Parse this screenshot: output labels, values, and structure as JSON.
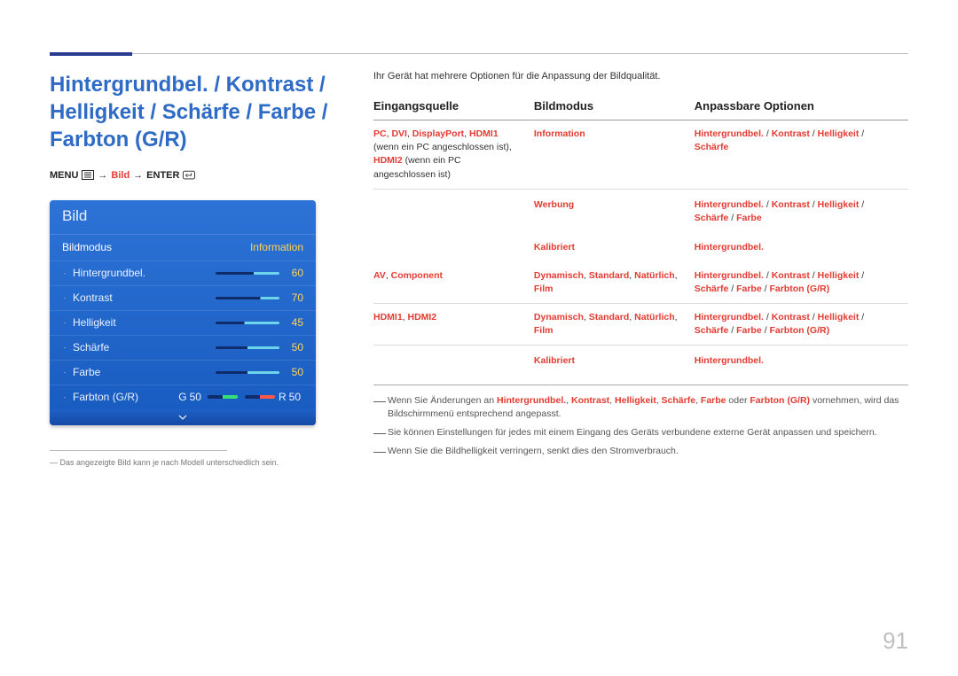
{
  "title": "Hintergrundbel. / Kontrast / Helligkeit / Schärfe / Farbe / Farbton (G/R)",
  "breadcrumb": {
    "menu": "MENU",
    "arrow": "→",
    "item": "Bild",
    "enter": "ENTER"
  },
  "menu": {
    "header": "Bild",
    "top_row": {
      "label": "Bildmodus",
      "value": "Information"
    },
    "rows": [
      {
        "label": "Hintergrundbel.",
        "value": "60",
        "pct": 60
      },
      {
        "label": "Kontrast",
        "value": "70",
        "pct": 70
      },
      {
        "label": "Helligkeit",
        "value": "45",
        "pct": 45
      },
      {
        "label": "Schärfe",
        "value": "50",
        "pct": 50
      },
      {
        "label": "Farbe",
        "value": "50",
        "pct": 50
      }
    ],
    "gr": {
      "label": "Farbton (G/R)",
      "g_lbl": "G",
      "g_val": "50",
      "r_lbl": "R",
      "r_val": "50"
    }
  },
  "footnote": "Das angezeigte Bild kann je nach Modell unterschiedlich sein.",
  "intro": "Ihr Gerät hat mehrere Optionen für die Anpassung der Bildqualität.",
  "table": {
    "headers": [
      "Eingangsquelle",
      "Bildmodus",
      "Anpassbare Optionen"
    ],
    "rows": [
      {
        "src_html": "<span class='red'>PC</span><span class='blk'>, </span><span class='red'>DVI</span><span class='blk'>, </span><span class='red'>DisplayPort</span><span class='blk'>, </span><span class='red'>HDMI1</span><span class='blk'> (wenn ein PC angeschlossen ist), </span><span class='red'>HDMI2</span><span class='blk'> (wenn ein PC angeschlossen ist)</span>",
        "mode_html": "<span class='red'>Information</span>",
        "opt_html": "<span class='red'>Hintergrundbel.</span><span class='blk'> / </span><span class='red'>Kontrast</span><span class='blk'> / </span><span class='red'>Helligkeit</span><span class='blk'> / </span><span class='red'>Schärfe</span>",
        "nb": false
      },
      {
        "src_html": "",
        "mode_html": "<span class='red'>Werbung</span>",
        "opt_html": "<span class='red'>Hintergrundbel.</span><span class='blk'> / </span><span class='red'>Kontrast</span><span class='blk'> / </span><span class='red'>Helligkeit</span><span class='blk'> / </span><span class='red'>Schärfe</span><span class='blk'> / </span><span class='red'>Farbe</span>",
        "nb": true
      },
      {
        "src_html": "",
        "mode_html": "<span class='red'>Kalibriert</span>",
        "opt_html": "<span class='red'>Hintergrundbel.</span>",
        "nb": true
      },
      {
        "src_html": "<span class='red'>AV</span><span class='blk'>, </span><span class='red'>Component</span>",
        "mode_html": "<span class='red'>Dynamisch</span><span class='blk'>, </span><span class='red'>Standard</span><span class='blk'>, </span><span class='red'>Natürlich</span><span class='blk'>, </span><span class='red'>Film</span>",
        "opt_html": "<span class='red'>Hintergrundbel.</span><span class='blk'> / </span><span class='red'>Kontrast</span><span class='blk'> / </span><span class='red'>Helligkeit</span><span class='blk'> / </span><span class='red'>Schärfe</span><span class='blk'> / </span><span class='red'>Farbe</span><span class='blk'> / </span><span class='red'>Farbton (G/R)</span>",
        "nb": false
      },
      {
        "src_html": "<span class='red'>HDMI1</span><span class='blk'>, </span><span class='red'>HDMI2</span>",
        "mode_html": "<span class='red'>Dynamisch</span><span class='blk'>, </span><span class='red'>Standard</span><span class='blk'>, </span><span class='red'>Natürlich</span><span class='blk'>, </span><span class='red'>Film</span>",
        "opt_html": "<span class='red'>Hintergrundbel.</span><span class='blk'> / </span><span class='red'>Kontrast</span><span class='blk'> / </span><span class='red'>Helligkeit</span><span class='blk'> / </span><span class='red'>Schärfe</span><span class='blk'> / </span><span class='red'>Farbe</span><span class='blk'> / </span><span class='red'>Farbton (G/R)</span>",
        "nb": false
      },
      {
        "src_html": "",
        "mode_html": "<span class='red'>Kalibriert</span>",
        "opt_html": "<span class='red'>Hintergrundbel.</span>",
        "nb": true
      }
    ]
  },
  "notes": [
    "Wenn Sie Änderungen an <span class='red'>Hintergrundbel.</span>, <span class='red'>Kontrast</span>, <span class='red'>Helligkeit</span>, <span class='red'>Schärfe</span>, <span class='red'>Farbe</span>  oder <span class='red'>Farbton (G/R)</span> vornehmen, wird das Bildschirmmenü entsprechend angepasst.",
    "Sie können Einstellungen für jedes mit einem Eingang des Geräts verbundene externe Gerät anpassen und speichern.",
    "Wenn Sie die Bildhelligkeit verringern, senkt dies den Stromverbrauch."
  ],
  "page_number": "91"
}
